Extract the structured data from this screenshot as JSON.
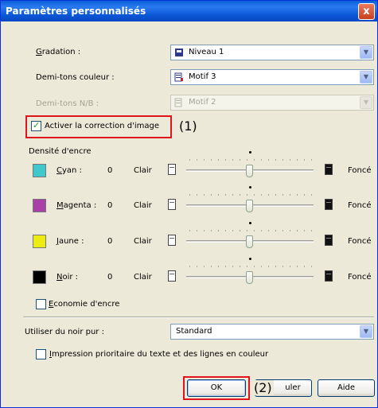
{
  "window": {
    "title": "Paramètres personnalisés",
    "close_glyph": "x"
  },
  "gradation": {
    "label": "Gradation :",
    "value": "Niveau 1",
    "icon": "printer-level-icon"
  },
  "halftone_color": {
    "label": "Demi-tons couleur :",
    "value": "Motif 3",
    "icon": "pattern-icon"
  },
  "halftone_bw": {
    "label": "Demi-tons N/B :",
    "value": "Motif 2",
    "icon": "pattern-icon",
    "disabled": true
  },
  "image_correction": {
    "label": "Activer la correction d'image",
    "checked": true,
    "annotation": "(1)"
  },
  "ink_density": {
    "title": "Densité d'encre",
    "light_label": "Clair",
    "dark_label": "Foncé",
    "rows": [
      {
        "name": "Cyan :",
        "value": "0",
        "color": "#40c8cc"
      },
      {
        "name": "Magenta :",
        "value": "0",
        "color": "#a840a8"
      },
      {
        "name": "Jaune :",
        "value": "0",
        "color": "#ecec10"
      },
      {
        "name": "Noir :",
        "value": "0",
        "color": "#000000"
      }
    ]
  },
  "ink_saving": {
    "label": "Economie d'encre",
    "checked": false
  },
  "pure_black": {
    "label": "Utiliser du noir pur :",
    "value": "Standard"
  },
  "priority_print": {
    "label": "Impression prioritaire du texte et des lignes en couleur",
    "checked": false
  },
  "buttons": {
    "ok": "OK",
    "cancel": "Annuler",
    "cancel_visible": "uler",
    "help": "Aide",
    "annotation": "(2)"
  }
}
